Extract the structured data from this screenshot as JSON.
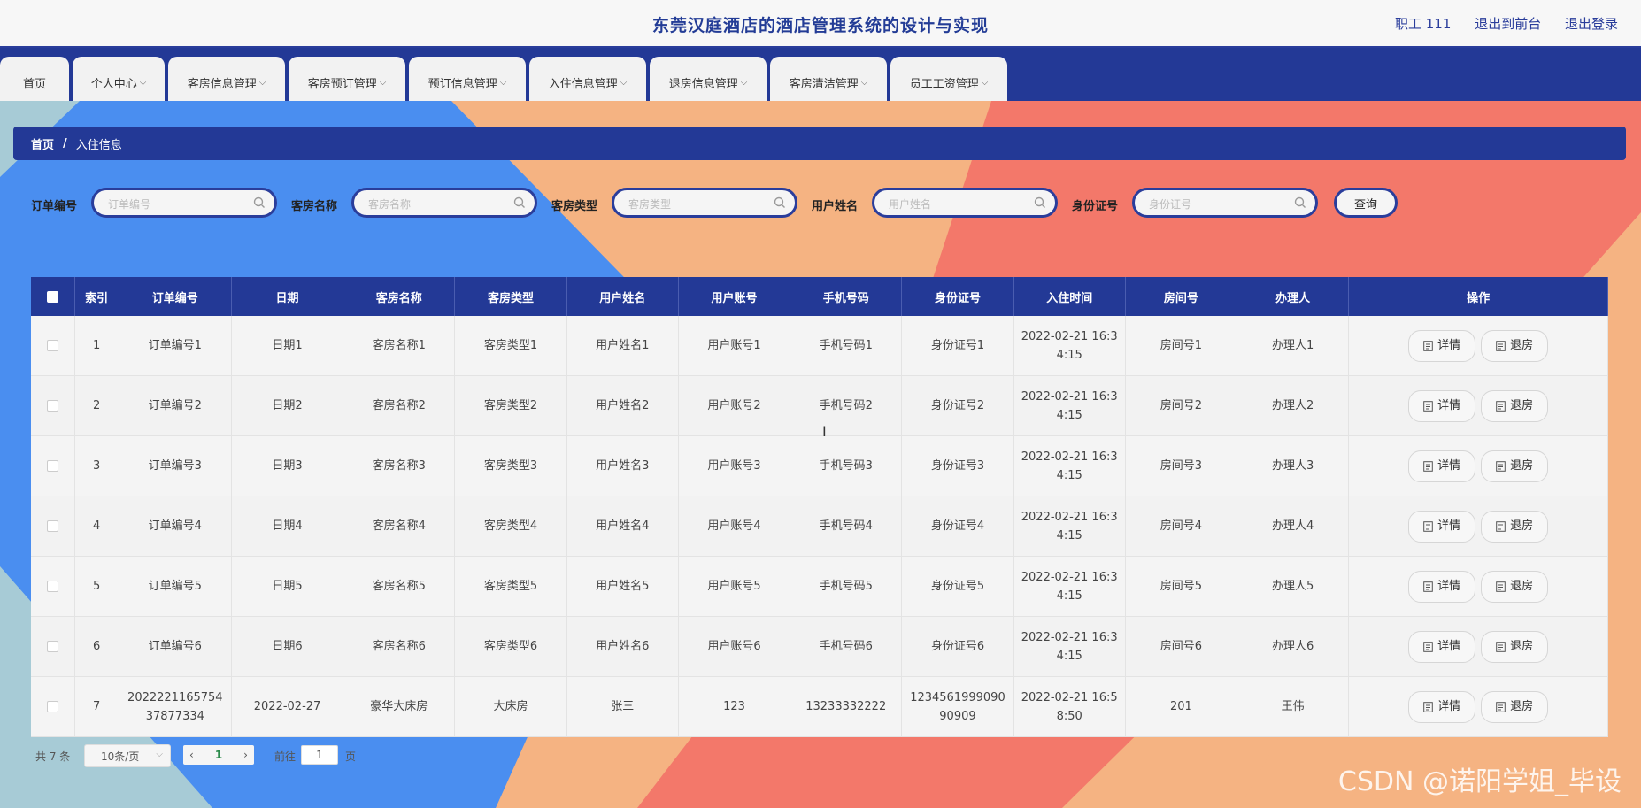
{
  "header": {
    "title": "东莞汉庭酒店的酒店管理系统的设计与实现",
    "user": "职工 111",
    "to_front": "退出到前台",
    "logout": "退出登录"
  },
  "nav": {
    "tabs": [
      {
        "label": "首页",
        "has_dropdown": false
      },
      {
        "label": "个人中心",
        "has_dropdown": true
      },
      {
        "label": "客房信息管理",
        "has_dropdown": true
      },
      {
        "label": "客房预订管理",
        "has_dropdown": true
      },
      {
        "label": "预订信息管理",
        "has_dropdown": true
      },
      {
        "label": "入住信息管理",
        "has_dropdown": true
      },
      {
        "label": "退房信息管理",
        "has_dropdown": true
      },
      {
        "label": "客房清洁管理",
        "has_dropdown": true
      },
      {
        "label": "员工工资管理",
        "has_dropdown": true
      }
    ]
  },
  "breadcrumb": {
    "home": "首页",
    "separator": "/",
    "current": "入住信息"
  },
  "search": {
    "fields": [
      {
        "label": "订单编号",
        "placeholder": "订单编号",
        "value": ""
      },
      {
        "label": "客房名称",
        "placeholder": "客房名称",
        "value": ""
      },
      {
        "label": "客房类型",
        "placeholder": "客房类型",
        "value": ""
      },
      {
        "label": "用户姓名",
        "placeholder": "用户姓名",
        "value": ""
      },
      {
        "label": "身份证号",
        "placeholder": "身份证号",
        "value": ""
      }
    ],
    "query_label": "查询"
  },
  "table": {
    "columns": [
      "索引",
      "订单编号",
      "日期",
      "客房名称",
      "客房类型",
      "用户姓名",
      "用户账号",
      "手机号码",
      "身份证号",
      "入住时间",
      "房间号",
      "办理人",
      "操作"
    ],
    "rows": [
      {
        "index": "1",
        "order_no": "订单编号1",
        "date": "日期1",
        "room_name": "客房名称1",
        "room_type": "客房类型1",
        "user_name": "用户姓名1",
        "account": "用户账号1",
        "phone": "手机号码1",
        "id_no": "身份证号1",
        "checkin_time": "2022-02-21 16:34:15",
        "room_no": "房间号1",
        "handler": "办理人1"
      },
      {
        "index": "2",
        "order_no": "订单编号2",
        "date": "日期2",
        "room_name": "客房名称2",
        "room_type": "客房类型2",
        "user_name": "用户姓名2",
        "account": "用户账号2",
        "phone": "手机号码2",
        "id_no": "身份证号2",
        "checkin_time": "2022-02-21 16:34:15",
        "room_no": "房间号2",
        "handler": "办理人2"
      },
      {
        "index": "3",
        "order_no": "订单编号3",
        "date": "日期3",
        "room_name": "客房名称3",
        "room_type": "客房类型3",
        "user_name": "用户姓名3",
        "account": "用户账号3",
        "phone": "手机号码3",
        "id_no": "身份证号3",
        "checkin_time": "2022-02-21 16:34:15",
        "room_no": "房间号3",
        "handler": "办理人3"
      },
      {
        "index": "4",
        "order_no": "订单编号4",
        "date": "日期4",
        "room_name": "客房名称4",
        "room_type": "客房类型4",
        "user_name": "用户姓名4",
        "account": "用户账号4",
        "phone": "手机号码4",
        "id_no": "身份证号4",
        "checkin_time": "2022-02-21 16:34:15",
        "room_no": "房间号4",
        "handler": "办理人4"
      },
      {
        "index": "5",
        "order_no": "订单编号5",
        "date": "日期5",
        "room_name": "客房名称5",
        "room_type": "客房类型5",
        "user_name": "用户姓名5",
        "account": "用户账号5",
        "phone": "手机号码5",
        "id_no": "身份证号5",
        "checkin_time": "2022-02-21 16:34:15",
        "room_no": "房间号5",
        "handler": "办理人5"
      },
      {
        "index": "6",
        "order_no": "订单编号6",
        "date": "日期6",
        "room_name": "客房名称6",
        "room_type": "客房类型6",
        "user_name": "用户姓名6",
        "account": "用户账号6",
        "phone": "手机号码6",
        "id_no": "身份证号6",
        "checkin_time": "2022-02-21 16:34:15",
        "room_no": "房间号6",
        "handler": "办理人6"
      },
      {
        "index": "7",
        "order_no": "2022221165754 37877334",
        "date": "2022-02-27",
        "room_name": "豪华大床房",
        "room_type": "大床房",
        "user_name": "张三",
        "account": "123",
        "phone": "13233332222",
        "id_no": "1234561999090 90909",
        "checkin_time": "2022-02-21 16:58:50",
        "room_no": "201",
        "handler": "王伟"
      }
    ],
    "actions": {
      "detail": "详情",
      "checkout": "退房"
    }
  },
  "pagination": {
    "total": "共 7 条",
    "page_size": "10条/页",
    "current_page": "1",
    "goto_label": "前往",
    "goto_value": "1",
    "page_suffix": "页"
  },
  "watermark": "CSDN @诺阳学姐_毕设",
  "colors": {
    "primary": "#233996",
    "bg_blue": "#4a8ef0",
    "bg_peach": "#f5b382",
    "bg_coral": "#f3786a",
    "bg_teal": "#a7cbd6"
  },
  "icons": {
    "search": "search-icon",
    "doc": "document-icon",
    "chevron": "chevron-down-icon"
  }
}
